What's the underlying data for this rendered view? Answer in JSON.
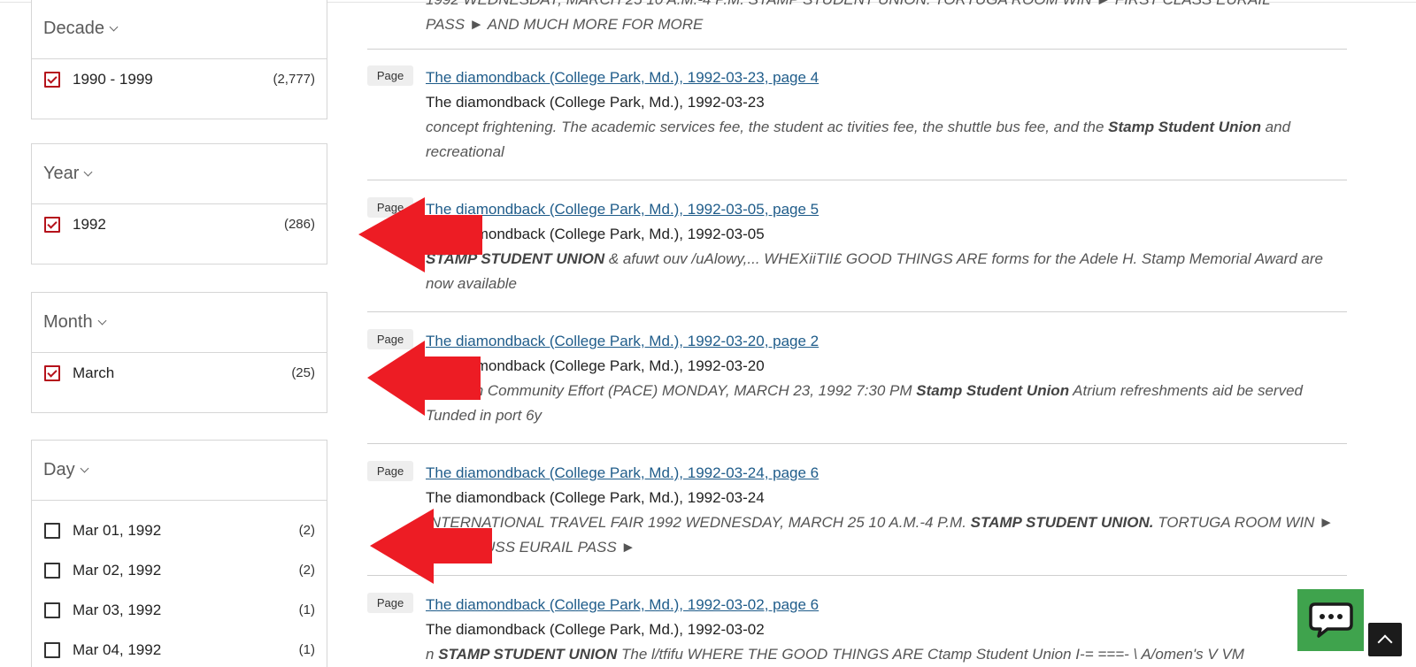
{
  "facets": [
    {
      "title": "Decade",
      "options": [
        {
          "label": "1990 - 1999",
          "count": "(2,777)",
          "checked": true
        }
      ]
    },
    {
      "title": "Year",
      "options": [
        {
          "label": "1992",
          "count": "(286)",
          "checked": true
        }
      ]
    },
    {
      "title": "Month",
      "options": [
        {
          "label": "March",
          "count": "(25)",
          "checked": true
        }
      ]
    },
    {
      "title": "Day",
      "options": [
        {
          "label": "Mar 01, 1992",
          "count": "(2)",
          "checked": false
        },
        {
          "label": "Mar 02, 1992",
          "count": "(2)",
          "checked": false
        },
        {
          "label": "Mar 03, 1992",
          "count": "(1)",
          "checked": false
        },
        {
          "label": "Mar 04, 1992",
          "count": "(1)",
          "checked": false
        }
      ]
    }
  ],
  "results": {
    "badge": "Page",
    "partial_top": {
      "line1": "1992 WEDNESDAY, MARCH 25 10 A.M.-4 P.M. STAMP STUDENT UNION. TORTUGA ROOM WIN ► FIRST CLASS EURAIL",
      "line2": "PASS ► AND MUCH MORE FOR MORE"
    },
    "items": [
      {
        "title": "The diamondback (College Park, Md.), 1992-03-23, page 4",
        "source": "The diamondback (College Park, Md.), 1992-03-23",
        "snippet_parts": [
          {
            "text": "concept frightening. The academic services fee, the student ac tivities fee, the shuttle bus fee, and the ",
            "bold": false
          },
          {
            "text": "Stamp Student Union",
            "bold": true
          },
          {
            "text": " and recreational",
            "bold": false
          }
        ]
      },
      {
        "title": "The diamondback (College Park, Md.), 1992-03-05, page 5",
        "source": "The diamondback (College Park, Md.), 1992-03-05",
        "snippet_parts": [
          {
            "text": "STAMP STUDENT UNION",
            "bold": true
          },
          {
            "text": " & afuwt ouv /uAlowy,... WHEXiiTII£ GOOD THINGS ARE forms for the Adele H. Stamp Memorial Award are now available",
            "bold": false
          }
        ]
      },
      {
        "title": "The diamondback (College Park, Md.), 1992-03-20, page 2",
        "source": "The diamondback (College Park, Md.), 1992-03-20",
        "snippet_parts": [
          {
            "text": "Nstive in Community Effort (PACE) MONDAY, MARCH 23, 1992 7:30 PM ",
            "bold": false
          },
          {
            "text": "Stamp Student Union",
            "bold": true
          },
          {
            "text": " Atrium refreshments aid be served Tunded in port 6y",
            "bold": false
          }
        ]
      },
      {
        "title": "The diamondback (College Park, Md.), 1992-03-24, page 6",
        "source": "The diamondback (College Park, Md.), 1992-03-24",
        "snippet_parts": [
          {
            "text": "INTERNATIONAL TRAVEL FAIR 1992 WEDNESDAY, MARCH 25 10 A.M.-4 P.M. ",
            "bold": false
          },
          {
            "text": "STAMP STUDENT UNION.",
            "bold": true
          },
          {
            "text": " TORTUGA ROOM WIN ► FIRST CUSS EURAIL PASS ►",
            "bold": false
          }
        ]
      },
      {
        "title": "The diamondback (College Park, Md.), 1992-03-02, page 6",
        "source": "The diamondback (College Park, Md.), 1992-03-02",
        "snippet_parts": [
          {
            "text": "n ",
            "bold": false
          },
          {
            "text": "STAMP STUDENT UNION",
            "bold": true
          },
          {
            "text": " The l/tfifu WHERE THE GOOD THINGS ARE Ctamp Student Union I-= ===- \\ A/omen's V VM",
            "bold": false
          }
        ]
      }
    ]
  },
  "colors": {
    "checkbox_checked": "#b5121b",
    "link": "#1f5c8a",
    "arrow": "#ed1c24",
    "chat_button": "#3fa34d",
    "scroll_top_button": "#1b1b1b"
  },
  "icons": {
    "facet_toggle": "chevron-down-icon",
    "chat": "chat-bubble-icon",
    "scroll_top": "chevron-up-icon",
    "annotation": "red-arrow-left"
  }
}
